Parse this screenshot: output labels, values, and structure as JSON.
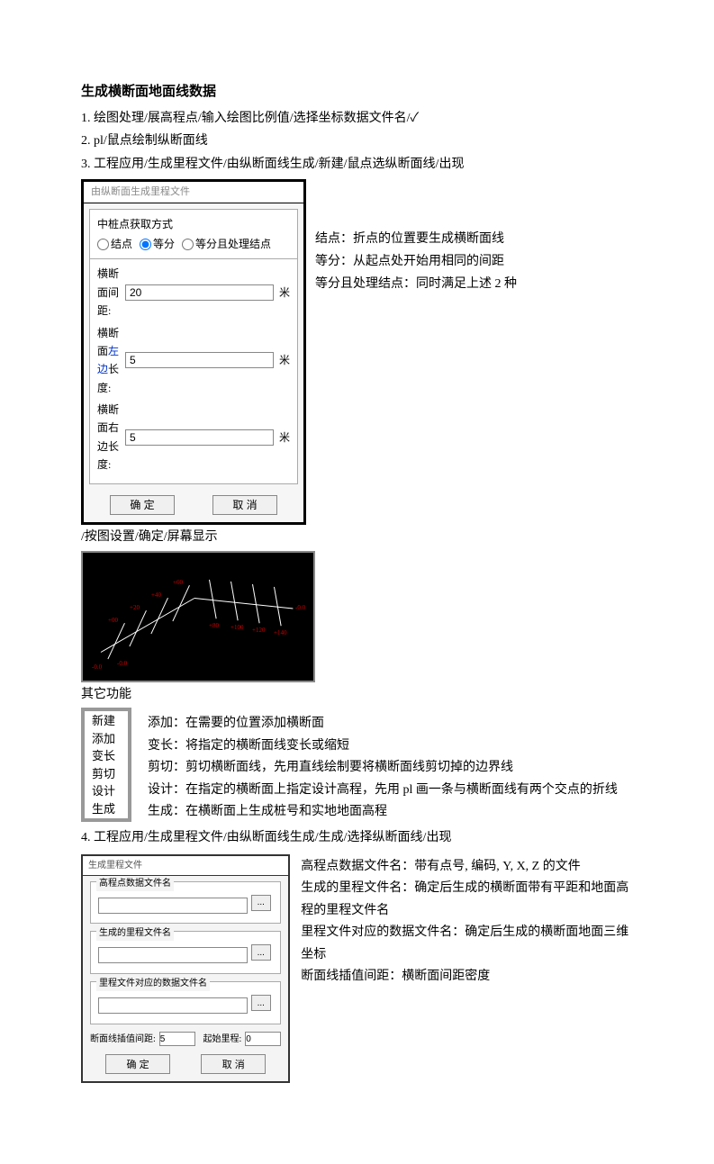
{
  "title": "生成横断面地面线数据",
  "steps": {
    "s1": "1. 绘图处理/展高程点/输入绘图比例值/选择坐标数据文件名/✓",
    "s2": "2. pl/鼠点绘制纵断面线",
    "s3": "3. 工程应用/生成里程文件/由纵断面线生成/新建/鼠点选纵断面线/出现",
    "s3b": "/按图设置/确定/屏幕显示",
    "other": "其它功能",
    "s4": "4.  工程应用/生成里程文件/由纵断面线生成/生成/选择纵断面线/出现"
  },
  "dialog1": {
    "title": "由纵断面生成里程文件",
    "legend": "中桩点获取方式",
    "radios": {
      "r1": "结点",
      "r2": "等分",
      "r3": "等分且处理结点"
    },
    "fields": {
      "f1lbl": "横断面间距:",
      "f1val": "20",
      "f2lbl": "横断面左边长度:",
      "f2lbl_b": "左边",
      "f2val": "5",
      "f3lbl": "横断面右边长度:",
      "f3val": "5",
      "unit": "米"
    },
    "ok": "确 定",
    "cancel": "取 消",
    "side1": "结点：折点的位置要生成横断面线",
    "side2": "等分：从起点处开始用相同的间距",
    "side3": "等分且处理结点：同时满足上述 2 种"
  },
  "menu": {
    "items": [
      "新建",
      "添加",
      "变长",
      "剪切",
      "设计",
      "生成"
    ],
    "desc": {
      "d1": "添加：在需要的位置添加横断面",
      "d2": "变长：将指定的横断面线变长或缩短",
      "d3": "剪切：剪切横断面线，先用直线绘制要将横断面线剪切掉的边界线",
      "d4": "设计：在指定的横断面上指定设计高程，先用 pl 画一条与横断面线有两个交点的折线",
      "d5": "生成：在横断面上生成桩号和实地地面高程"
    }
  },
  "dialog2": {
    "title": "生成里程文件",
    "g1": "高程点数据文件名",
    "g2": "生成的里程文件名",
    "g3": "里程文件对应的数据文件名",
    "browse": "...",
    "lblA": "断面线插值间距:",
    "valA": "5",
    "lblB": "起始里程:",
    "valB": "0",
    "ok": "确 定",
    "cancel": "取 消",
    "side": {
      "l1": "高程点数据文件名：带有点号, 编码, Y, X, Z 的文件",
      "l2": "生成的里程文件名：确定后生成的横断面带有平距和地面高程的里程文件名",
      "l3": "里程文件对应的数据文件名：确定后生成的横断面地面三维坐标",
      "l4": "断面线插值间距：横断面间距密度"
    }
  }
}
